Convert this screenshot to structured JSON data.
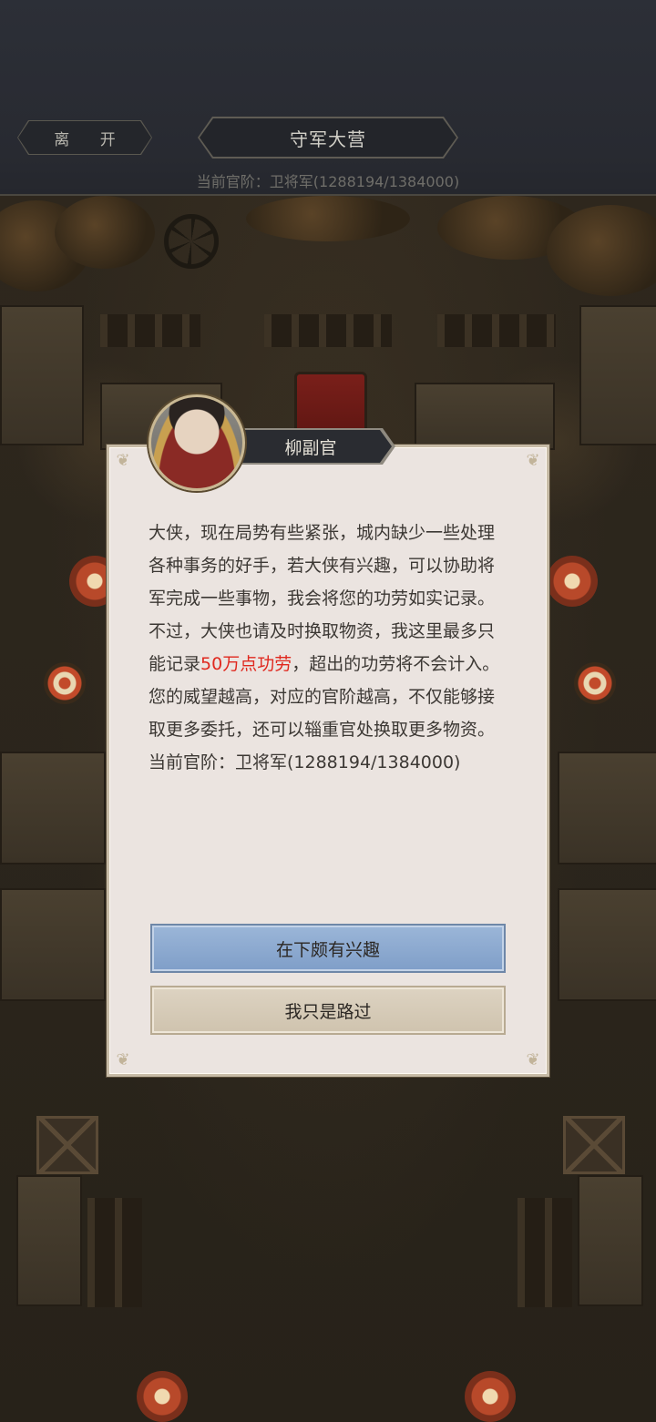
{
  "header": {
    "leave_label": "离 开",
    "title": "守军大营",
    "rank_line": "当前官阶：卫将军(1288194/1384000)"
  },
  "dialog": {
    "speaker": "柳副官",
    "paragraph1": "大侠，现在局势有些紧张，城内缺少一些处理各种事务的好手，若大侠有兴趣，可以协助将军完成一些事物，我会将您的功劳如实记录。",
    "paragraph2_before": "不过，大侠也请及时换取物资，我这里最多只能记录",
    "paragraph2_highlight": "50万点功劳",
    "paragraph2_after": "，超出的功劳将不会计入。",
    "paragraph3": "您的威望越高，对应的官阶越高，不仅能够接取更多委托，还可以辎重官处换取更多物资。",
    "rank_line": "当前官阶：卫将军(1288194/1384000)",
    "highlight_color": "#e0281e"
  },
  "buttons": {
    "accept_label": "在下颇有兴趣",
    "decline_label": "我只是路过"
  },
  "icons": {
    "avatar": "officer-portrait",
    "corners": "ornament-corner"
  }
}
